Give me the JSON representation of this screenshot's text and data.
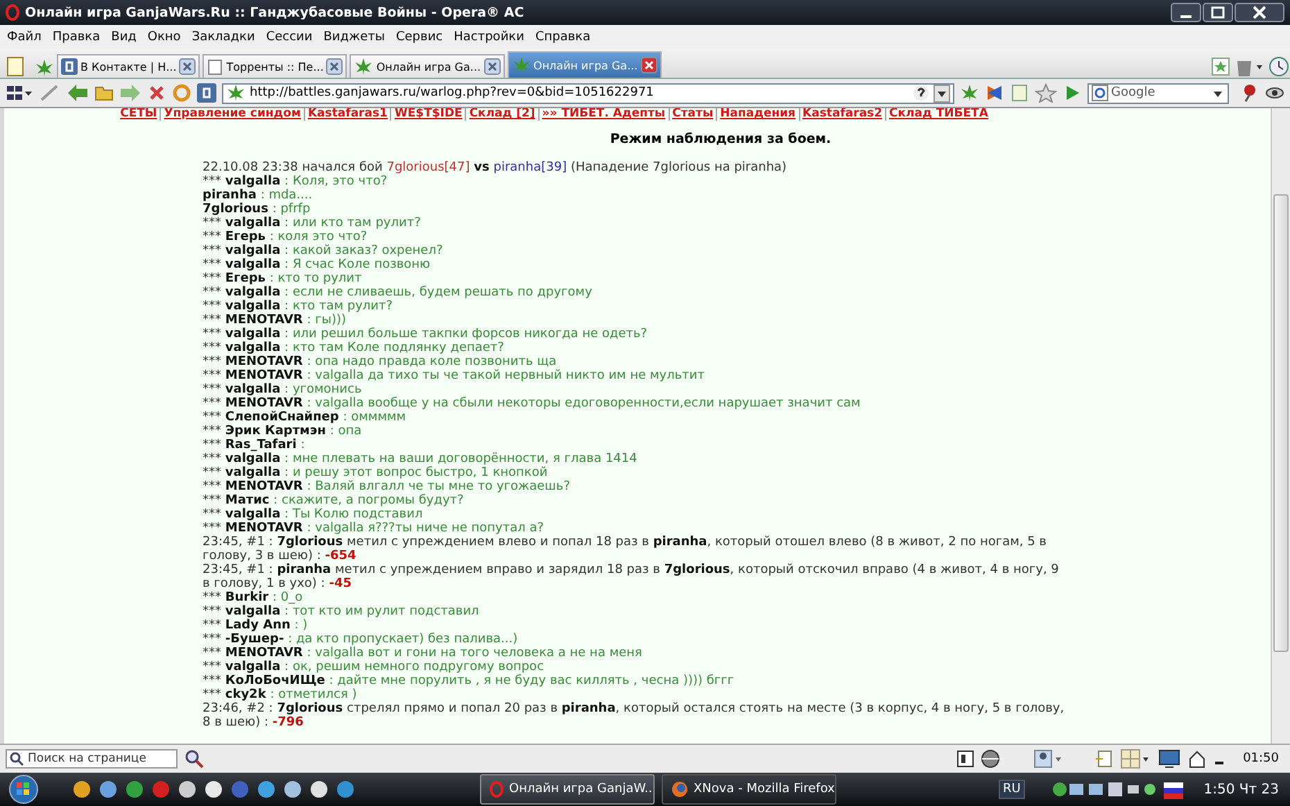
{
  "window": {
    "title": "Онлайн игра GanjaWars.Ru :: Ганджубасовые Войны - Opera® AC"
  },
  "menu": [
    "Файл",
    "Правка",
    "Вид",
    "Окно",
    "Закладки",
    "Сессии",
    "Виджеты",
    "Сервис",
    "Настройки",
    "Справка"
  ],
  "tabs": [
    {
      "label": "В Контакте | Н...",
      "selected": false
    },
    {
      "label": "Торренты :: Пе...",
      "selected": false
    },
    {
      "label": "Онлайн игра Ga...",
      "selected": false
    },
    {
      "label": "Онлайн игра Ga...",
      "selected": true
    }
  ],
  "address_bar": {
    "url": "http://battles.ganjawars.ru/warlog.php?rev=0&bid=1051622971",
    "search_placeholder": "Google"
  },
  "page": {
    "nav_links": [
      "СЕТЫ",
      "Управление синдом",
      "Kastafaras1",
      "WE$T$IDE",
      "Склад [2]",
      "»» ТИБЕТ. Адепты",
      "Статы",
      "Нападения",
      "Kastafaras2",
      "Склад ТИБЕТА"
    ],
    "heading": "Режим наблюдения за боем.",
    "log": [
      {
        "kind": "start",
        "text": "22.10.08 23:38 начался бой",
        "attacker": "7glorious[47]",
        "vs": "vs",
        "defender": "piranha[39]",
        "note": "(Нападение 7glorious на piranha)"
      },
      {
        "kind": "chat",
        "marker": "***",
        "nick": "valgalla",
        "message": ": Коля, это что?"
      },
      {
        "kind": "chat",
        "nick": "piranha",
        "message": ": mda...."
      },
      {
        "kind": "chat",
        "nick": "7glorious",
        "message": ": pfrfp"
      },
      {
        "kind": "chat",
        "marker": "***",
        "nick": "valgalla",
        "message": ": или кто там рулит?"
      },
      {
        "kind": "chat",
        "marker": "***",
        "nick": "Егерь",
        "message": ": коля это что?"
      },
      {
        "kind": "chat",
        "marker": "***",
        "nick": "valgalla",
        "message": ": какой заказ? охренел?"
      },
      {
        "kind": "chat",
        "marker": "***",
        "nick": "valgalla",
        "message": ": Я счас Коле позвоню"
      },
      {
        "kind": "chat",
        "marker": "***",
        "nick": "Егерь",
        "message": ": кто то рулит"
      },
      {
        "kind": "chat",
        "marker": "***",
        "nick": "valgalla",
        "message": ": если не сливаешь, будем решать по другому"
      },
      {
        "kind": "chat",
        "marker": "***",
        "nick": "valgalla",
        "message": ": кто там рулит?"
      },
      {
        "kind": "chat",
        "marker": "***",
        "nick": "MENOTAVR",
        "message": ": гы)))"
      },
      {
        "kind": "chat",
        "marker": "***",
        "nick": "valgalla",
        "message": ": или решил больше такпки форсов никогда не одеть?"
      },
      {
        "kind": "chat",
        "marker": "***",
        "nick": "valgalla",
        "message": ": кто там Коле подлянку депает?"
      },
      {
        "kind": "chat",
        "marker": "***",
        "nick": "MENOTAVR",
        "message": ": опа надо правда коле позвонить ща"
      },
      {
        "kind": "chat",
        "marker": "***",
        "nick": "MENOTAVR",
        "message": ": valgalla да тихо ты че такой нервный никто им не мультит"
      },
      {
        "kind": "chat",
        "marker": "***",
        "nick": "valgalla",
        "message": ": угомонись"
      },
      {
        "kind": "chat",
        "marker": "***",
        "nick": "MENOTAVR",
        "message": ": valgalla вообще у на сбыли некоторы едоговоренности,если нарушает значит сам"
      },
      {
        "kind": "chat",
        "marker": "***",
        "nick": "СлепойСнайпер",
        "message": ": оммммм"
      },
      {
        "kind": "chat",
        "marker": "***",
        "nick": "Эрик Картмэн",
        "message": ": опа"
      },
      {
        "kind": "chat",
        "marker": "***",
        "nick": "Ras_Tafari",
        "message": ":"
      },
      {
        "kind": "chat",
        "marker": "***",
        "nick": "valgalla",
        "message": ": мне плевать на ваши договорённости, я глава 1414"
      },
      {
        "kind": "chat",
        "marker": "***",
        "nick": "valgalla",
        "message": ": и решу этот вопрос быстро, 1 кнопкой"
      },
      {
        "kind": "chat",
        "marker": "***",
        "nick": "MENOTAVR",
        "message": ": Валяй влгалл че ты мне то угожаешь?"
      },
      {
        "kind": "chat",
        "marker": "***",
        "nick": "Матис",
        "message": ": скажите, а погромы будут?"
      },
      {
        "kind": "chat",
        "marker": "***",
        "nick": "valgalla",
        "message": ": Ты Колю подставил"
      },
      {
        "kind": "chat",
        "marker": "***",
        "nick": "MENOTAVR",
        "message": ": valgalla я???ты ниче не попутал а?"
      },
      {
        "kind": "hit",
        "text": "23:45, #1 : **7glorious** метил с упреждением влево и попал 18 раз в **piranha**, который отошел влево (8 в живот, 2 по ногам, 5 в голову, 3 в шею) :",
        "damage": "-654"
      },
      {
        "kind": "hit",
        "text": "23:45, #1 : **piranha** метил с упреждением вправо и зарядил 18 раз в **7glorious**, который отскочил вправо (4 в живот, 4 в ногу, 9 в голову, 1 в ухо) :",
        "damage": "-45"
      },
      {
        "kind": "chat",
        "marker": "***",
        "nick": "Burkir",
        "message": ": 0_о"
      },
      {
        "kind": "chat",
        "marker": "***",
        "nick": "valgalla",
        "message": ": тот кто им рулит подставил"
      },
      {
        "kind": "chat",
        "marker": "***",
        "nick": "Lady Ann",
        "message": ": )"
      },
      {
        "kind": "chat",
        "marker": "***",
        "nick": "-Бушер-",
        "message": ": да кто пропускает) без палива...)"
      },
      {
        "kind": "chat",
        "marker": "***",
        "nick": "MENOTAVR",
        "message": ": valgalla вот и гони на того человека а не на меня"
      },
      {
        "kind": "chat",
        "marker": "***",
        "nick": "valgalla",
        "message": ": ок, решим немного подругому вопрос"
      },
      {
        "kind": "chat",
        "marker": "***",
        "nick": "КоЛоБочИЩе",
        "message": ": дайте мне порулить , я не буду вас киллять , чесна )))) бггг"
      },
      {
        "kind": "chat",
        "marker": "***",
        "nick": "cky2k",
        "message": ": отметился )"
      },
      {
        "kind": "hit",
        "text": "23:46, #2 : **7glorious** стрелял прямо и попал 20 раз в **piranha**, который остался стоять на месте (3 в корпус, 4 в ногу, 5 в голову, 8 в шею) :",
        "damage": "-796"
      }
    ]
  },
  "status_bar": {
    "find_placeholder": "Поиск на странице",
    "time": "01:50"
  },
  "taskbar": {
    "tasks": [
      {
        "label": "Онлайн игра GanjaW...",
        "selected": true
      },
      {
        "label": "XNova - Mozilla Firefox",
        "selected": false
      }
    ],
    "language": "RU",
    "clock": "1:50 Чт 23"
  }
}
